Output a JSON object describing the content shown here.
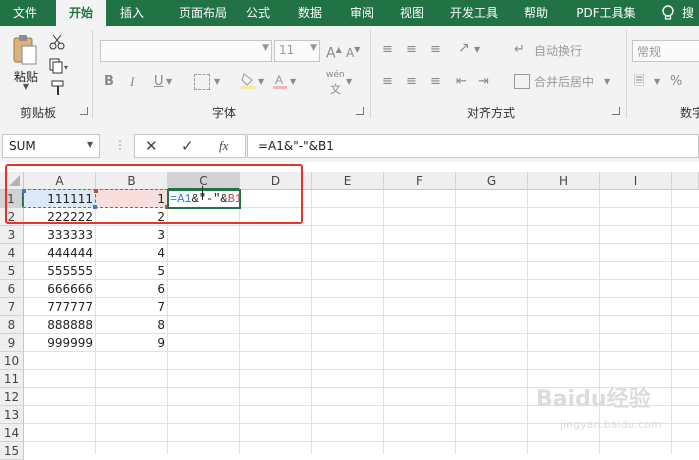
{
  "menu": {
    "tabs": [
      {
        "label": "文件",
        "active": false
      },
      {
        "label": "开始",
        "active": true
      },
      {
        "label": "插入",
        "active": false
      },
      {
        "label": "页面布局",
        "active": false
      },
      {
        "label": "公式",
        "active": false
      },
      {
        "label": "数据",
        "active": false
      },
      {
        "label": "审阅",
        "active": false
      },
      {
        "label": "视图",
        "active": false
      },
      {
        "label": "开发工具",
        "active": false
      },
      {
        "label": "帮助",
        "active": false
      },
      {
        "label": "PDF工具集",
        "active": false
      }
    ]
  },
  "ribbon": {
    "clipboard": {
      "paste_label": "粘贴",
      "group_label": "剪贴板"
    },
    "font": {
      "font_name": "",
      "font_size": "11",
      "bold": "B",
      "italic": "I",
      "underline": "U",
      "phonetic": "wén",
      "group_label": "字体"
    },
    "alignment": {
      "wrap_text": "自动换行",
      "merge_center": "合并后居中",
      "group_label": "对齐方式"
    },
    "number": {
      "format": "常规",
      "group_label": "数字"
    }
  },
  "formula_bar": {
    "name_box": "SUM",
    "fx": "fx",
    "content": "=A1&\"-\"&B1"
  },
  "columns": [
    "A",
    "B",
    "C",
    "D",
    "E",
    "F",
    "G",
    "H",
    "I"
  ],
  "selected_column": "C",
  "selected_row": 1,
  "rows": [
    {
      "n": "1",
      "a": "111111",
      "b": "1"
    },
    {
      "n": "2",
      "a": "222222",
      "b": "2"
    },
    {
      "n": "3",
      "a": "333333",
      "b": "3"
    },
    {
      "n": "4",
      "a": "444444",
      "b": "4"
    },
    {
      "n": "5",
      "a": "555555",
      "b": "5"
    },
    {
      "n": "6",
      "a": "666666",
      "b": "6"
    },
    {
      "n": "7",
      "a": "777777",
      "b": "7"
    },
    {
      "n": "8",
      "a": "888888",
      "b": "8"
    },
    {
      "n": "9",
      "a": "999999",
      "b": "9"
    },
    {
      "n": "10",
      "a": "",
      "b": ""
    },
    {
      "n": "11",
      "a": "",
      "b": ""
    },
    {
      "n": "12",
      "a": "",
      "b": ""
    },
    {
      "n": "13",
      "a": "",
      "b": ""
    },
    {
      "n": "14",
      "a": "",
      "b": ""
    },
    {
      "n": "15",
      "a": "",
      "b": ""
    }
  ],
  "editing_cell": {
    "ref_a": "=A1",
    "amp1": "&",
    "quoted": "\"-\"",
    "amp2": "&",
    "ref_b": "B1"
  },
  "colors": {
    "excel_green": "#217346",
    "ref_a": "#3c78d8",
    "ref_b": "#c0504d",
    "highlight": "#e8322b"
  },
  "watermark": {
    "brand": "Baidu经验",
    "url": "jingyan.baidu.com"
  }
}
